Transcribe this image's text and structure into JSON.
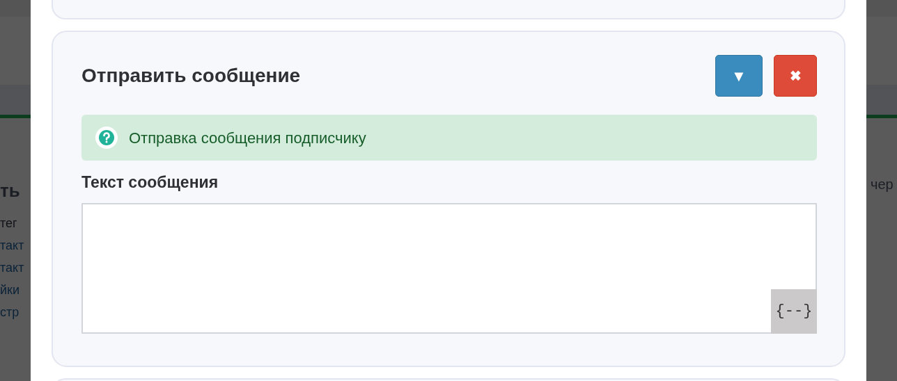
{
  "background_page": {
    "heading_fragment": "ть",
    "lines": [
      {
        "text": "тег",
        "kind": "text"
      },
      {
        "text": "такт",
        "kind": "link"
      },
      {
        "text": "такт",
        "kind": "link"
      },
      {
        "text": "йки",
        "kind": "link"
      },
      {
        "text": "стр",
        "kind": "link"
      }
    ],
    "right_fragment": "чер"
  },
  "card": {
    "title": "Отправить сообщение",
    "collapse_button": "▼",
    "close_button": "✖",
    "alert": "Отправка сообщения подписчику",
    "field_label": "Текст сообщения",
    "variables_button": "{--}"
  }
}
